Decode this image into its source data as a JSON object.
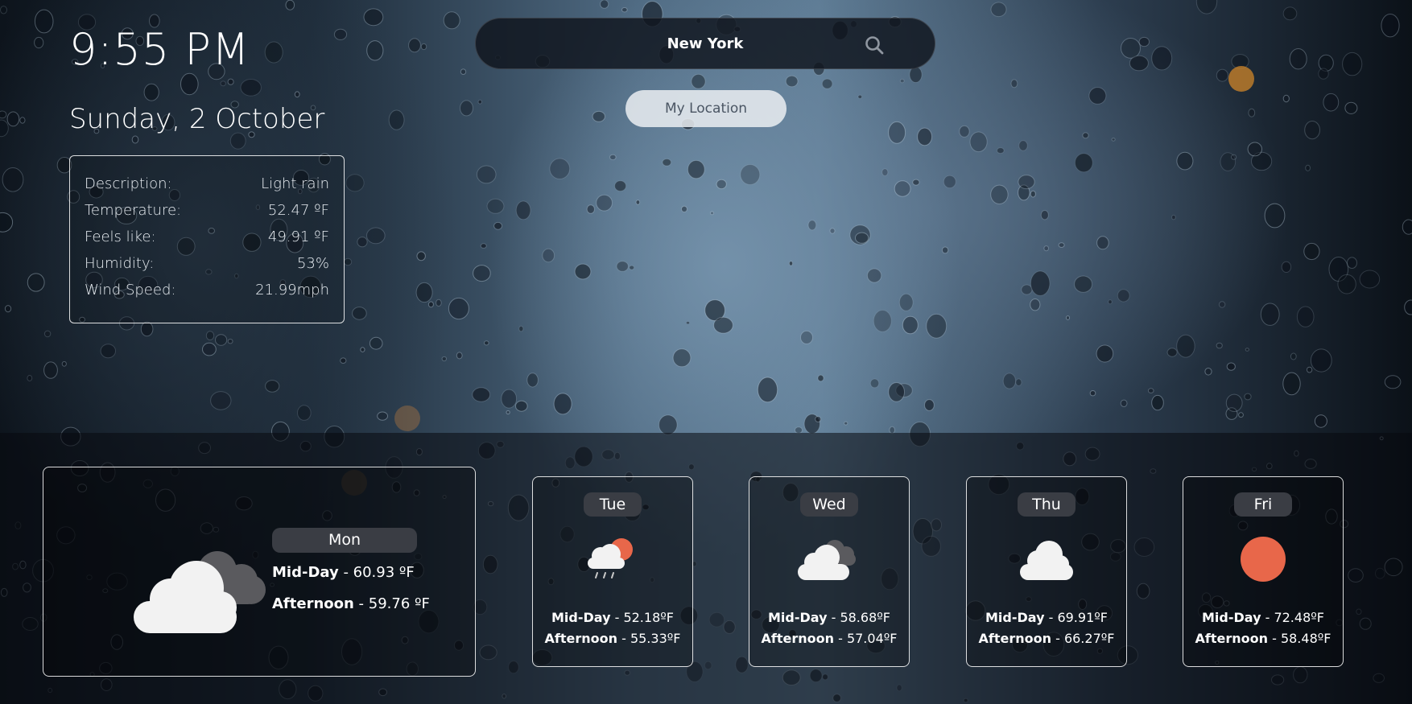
{
  "clock": {
    "time": "9:55 PM",
    "date": "Sunday, 2 October"
  },
  "current": {
    "rows": [
      {
        "label": "Description:",
        "value": "Light rain"
      },
      {
        "label": "Temperature:",
        "value": "52.47 ºF"
      },
      {
        "label": "Feels like:",
        "value": "49.91 ºF"
      },
      {
        "label": "Humidity:",
        "value": "53%"
      },
      {
        "label": "Wind Speed:",
        "value": "21.99mph"
      }
    ]
  },
  "search": {
    "value": "New York",
    "icon": "search-icon"
  },
  "location_button": "My Location",
  "colors": {
    "sun": "#e8674a",
    "cloud": "#f2f2f2",
    "dark_cloud": "#5a5a5e",
    "pill": "#3a3d44"
  },
  "today": {
    "day": "Mon",
    "icon": "cloudy-icon",
    "midday_label": "Mid-Day",
    "midday_value": " - 60.93 ºF",
    "afternoon_label": "Afternoon",
    "afternoon_value": " - 59.76 ºF"
  },
  "forecast": [
    {
      "day": "Tue",
      "icon": "light-rain-sun-icon",
      "midday_label": "Mid-Day",
      "midday_value": " - 52.18ºF",
      "afternoon_label": "Afternoon",
      "afternoon_value": " - 55.33ºF"
    },
    {
      "day": "Wed",
      "icon": "cloudy-icon",
      "midday_label": "Mid-Day",
      "midday_value": " - 58.68ºF",
      "afternoon_label": "Afternoon",
      "afternoon_value": " - 57.04ºF"
    },
    {
      "day": "Thu",
      "icon": "cloud-icon",
      "midday_label": "Mid-Day",
      "midday_value": " - 69.91ºF",
      "afternoon_label": "Afternoon",
      "afternoon_value": " - 66.27ºF"
    },
    {
      "day": "Fri",
      "icon": "sun-icon",
      "midday_label": "Mid-Day",
      "midday_value": " - 72.48ºF",
      "afternoon_label": "Afternoon",
      "afternoon_value": " - 58.48ºF"
    }
  ]
}
